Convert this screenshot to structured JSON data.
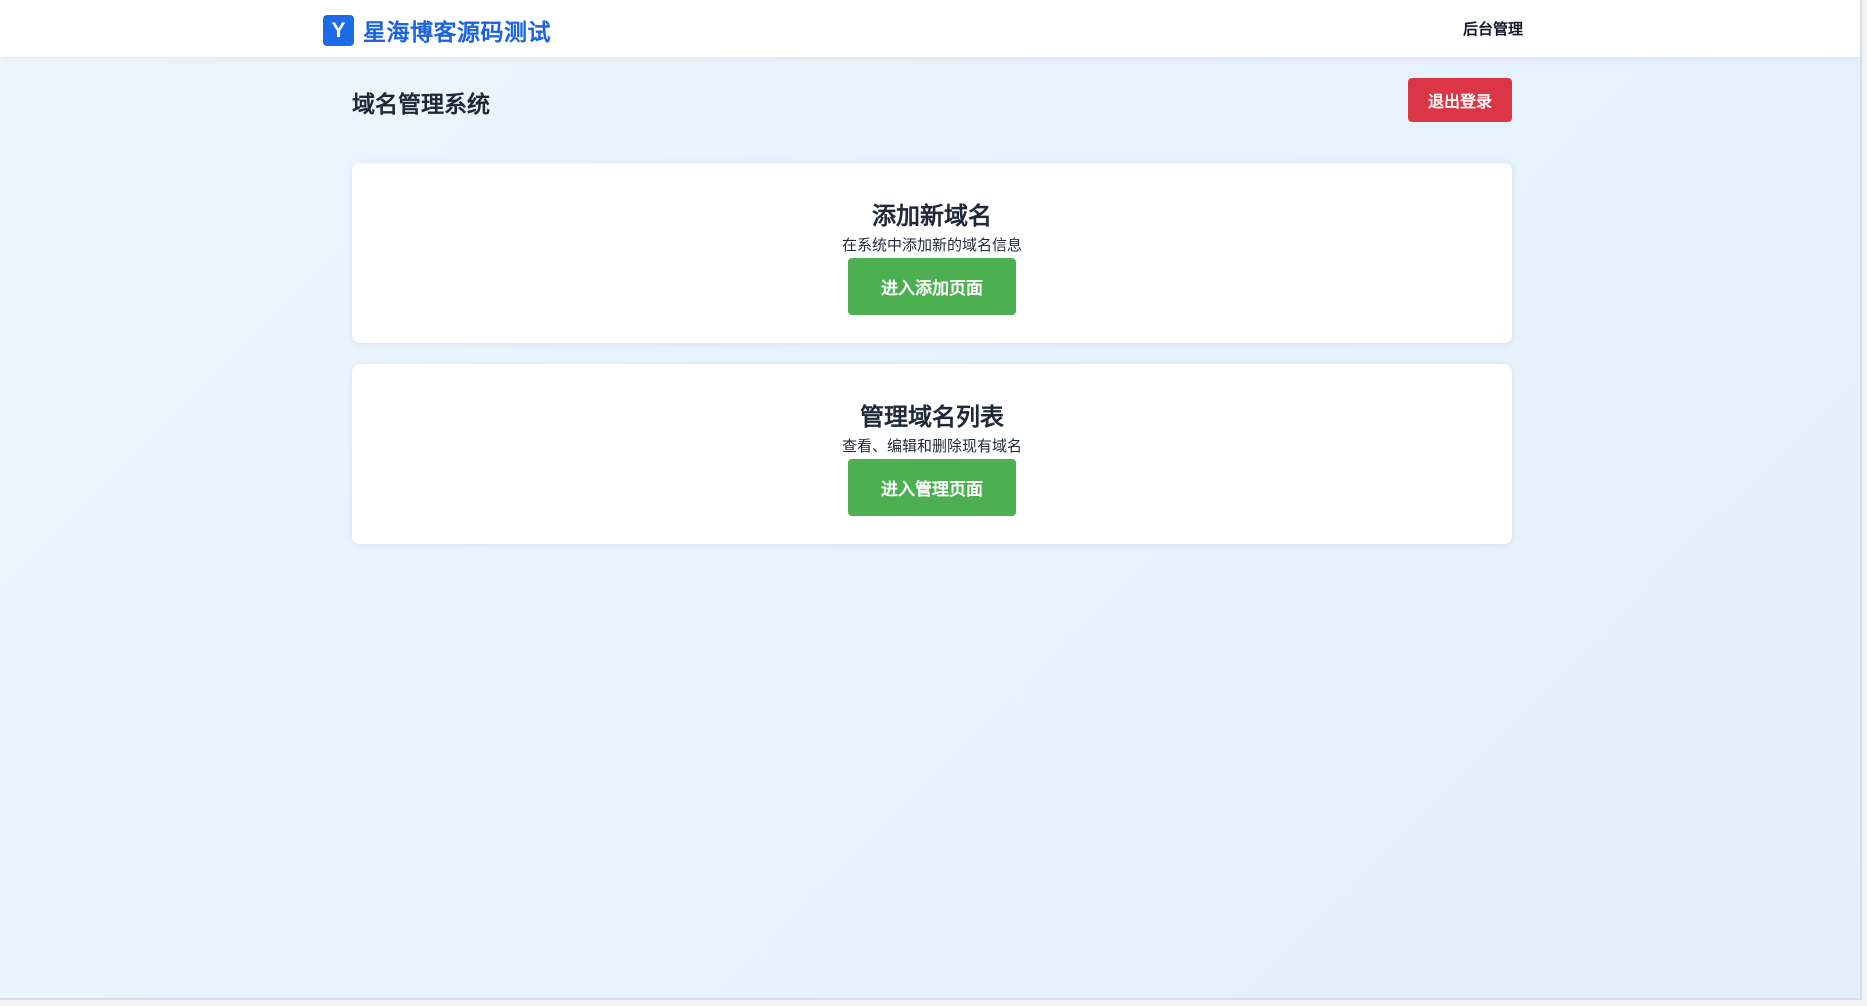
{
  "brand": {
    "logo_letter": "Y",
    "name": "星海博客源码测试"
  },
  "nav": {
    "admin_label": "后台管理"
  },
  "page": {
    "title": "域名管理系统",
    "logout_label": "退出登录"
  },
  "cards": [
    {
      "title": "添加新域名",
      "description": "在系统中添加新的域名信息",
      "button_label": "进入添加页面"
    },
    {
      "title": "管理域名列表",
      "description": "查看、编辑和删除现有域名",
      "button_label": "进入管理页面"
    }
  ],
  "colors": {
    "brand": "#1c63e2",
    "logout": "#dc3545",
    "primary_action": "#4caf50",
    "background": "#e7f2fc"
  }
}
